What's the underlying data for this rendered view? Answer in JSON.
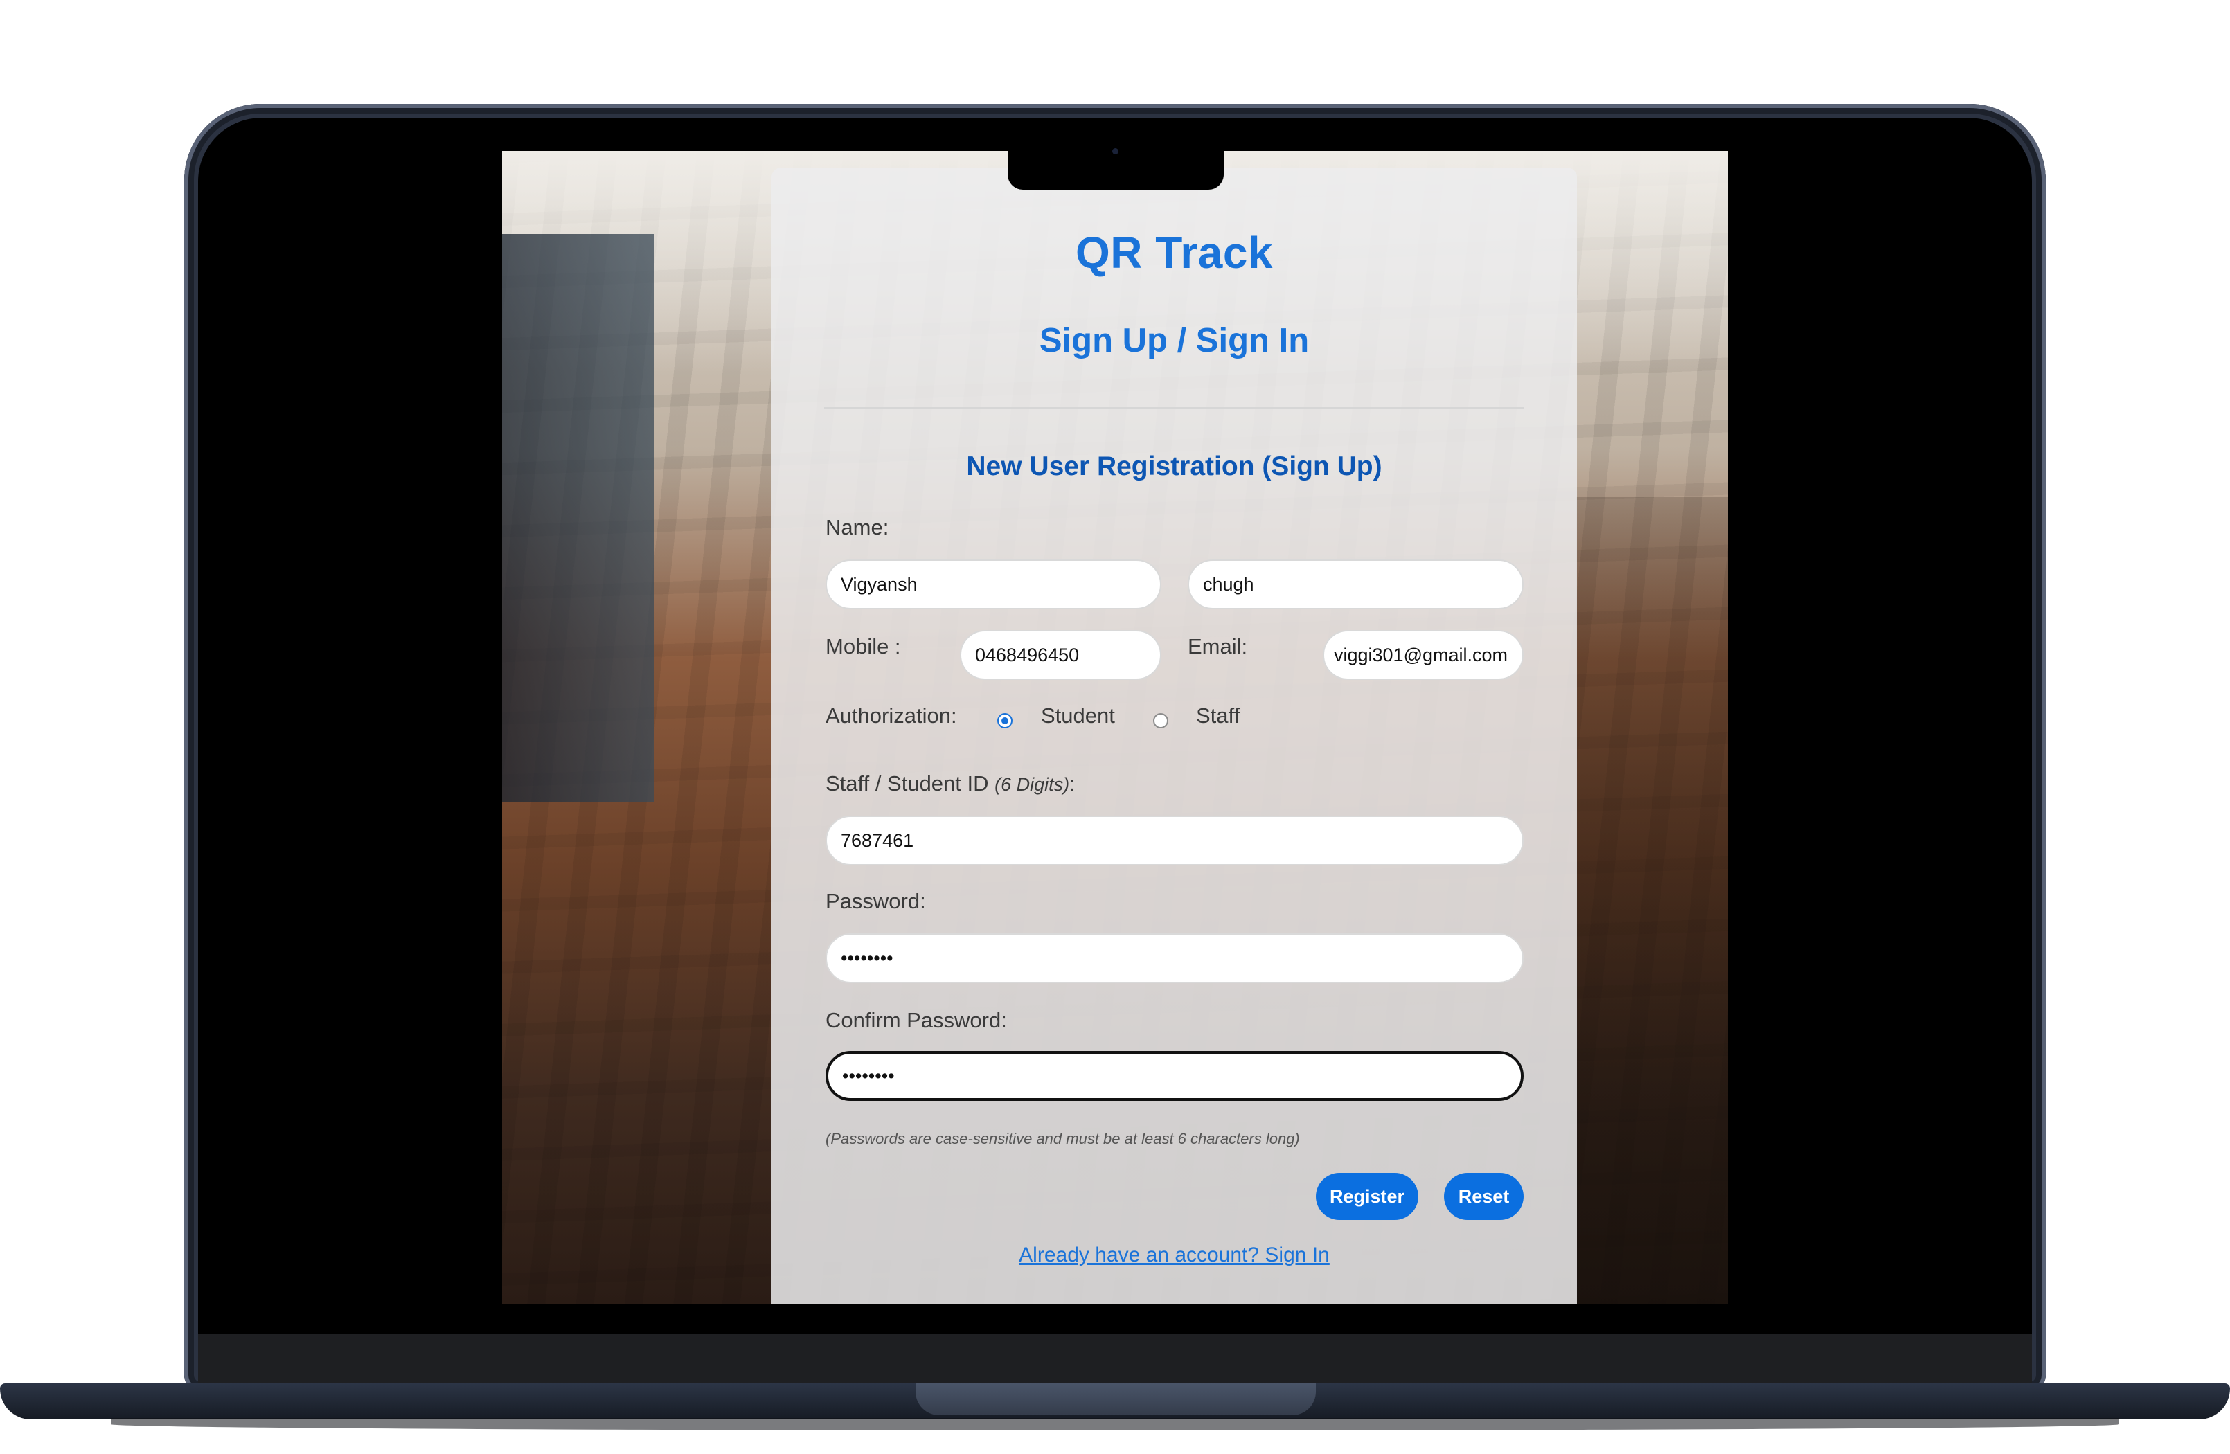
{
  "app": {
    "title": "QR Track",
    "subtitle": "Sign Up / Sign In"
  },
  "form": {
    "heading": "New User Registration (Sign Up)",
    "name_label": "Name:",
    "first_name": "Vigyansh",
    "last_name": "chugh",
    "mobile_label": "Mobile :",
    "mobile": "0468496450",
    "email_label": "Email:",
    "email": "viggi301@gmail.com",
    "authorization_label": "Authorization:",
    "auth_options": [
      {
        "label": "Student",
        "checked": true
      },
      {
        "label": "Staff",
        "checked": false
      }
    ],
    "id_label": "Staff / Student ID",
    "id_hint": "(6 Digits)",
    "id_suffix": ":",
    "staff_student_id": "7687461",
    "password_label": "Password:",
    "password_mask": "••••••••",
    "confirm_label": "Confirm Password:",
    "confirm_mask": "••••••••",
    "password_hint": "(Passwords are case-sensitive and must be at least 6 characters long)",
    "register_label": "Register",
    "reset_label": "Reset",
    "signin_link": "Already have an account? Sign In"
  },
  "colors": {
    "accent": "#1a73d9",
    "heading": "#0d56b3",
    "button": "#0b6fe0"
  }
}
